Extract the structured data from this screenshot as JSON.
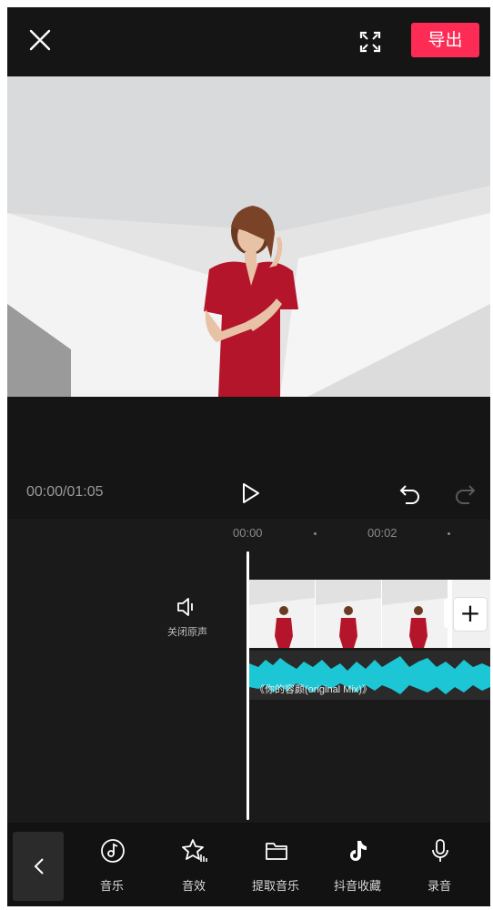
{
  "header": {
    "export_label": "导出",
    "icons": [
      "close-icon",
      "fullscreen-icon"
    ]
  },
  "player": {
    "timecode": "00:00/01:05",
    "icons": [
      "play-icon",
      "undo-icon",
      "redo-icon"
    ]
  },
  "timeline": {
    "ruler": [
      "00:00",
      "00:02"
    ],
    "mute_label": "关闭原声",
    "audio_label": "《你的容颜(original Mix)》",
    "add_clip": "+"
  },
  "toolbar": {
    "items": [
      {
        "label": "音乐",
        "icon": "music-icon"
      },
      {
        "label": "音效",
        "icon": "sound-effect-icon"
      },
      {
        "label": "提取音乐",
        "icon": "folder-icon"
      },
      {
        "label": "抖音收藏",
        "icon": "tiktok-icon"
      },
      {
        "label": "录音",
        "icon": "microphone-icon"
      }
    ]
  },
  "colors": {
    "accent": "#fe2c55",
    "waveform": "#1cc6d4",
    "background": "#111111",
    "dress": "#b5152b"
  }
}
